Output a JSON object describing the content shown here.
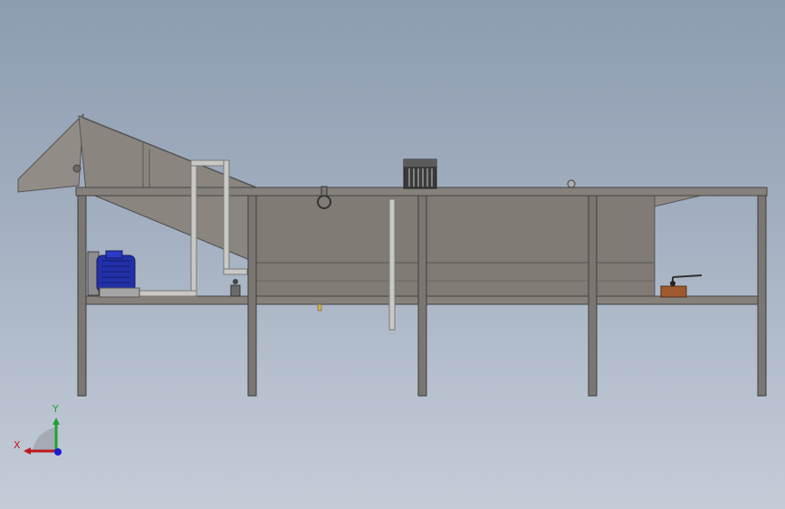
{
  "viewport": {
    "background_top": "#8d9cb0",
    "background_bottom": "#c4ccd8"
  },
  "model": {
    "frame_color": "#7e7a76",
    "tank_color": "#807b75",
    "hopper_color": "#8a857f",
    "pipe_color": "#c9c8c4",
    "motor_color": "#2230a8",
    "valve_color": "#a0582e"
  },
  "triad": {
    "x_label": "X",
    "y_label": "Y",
    "x_color": "#c0171e",
    "y_color": "#1ea034",
    "z_color": "#1c1ccf"
  }
}
